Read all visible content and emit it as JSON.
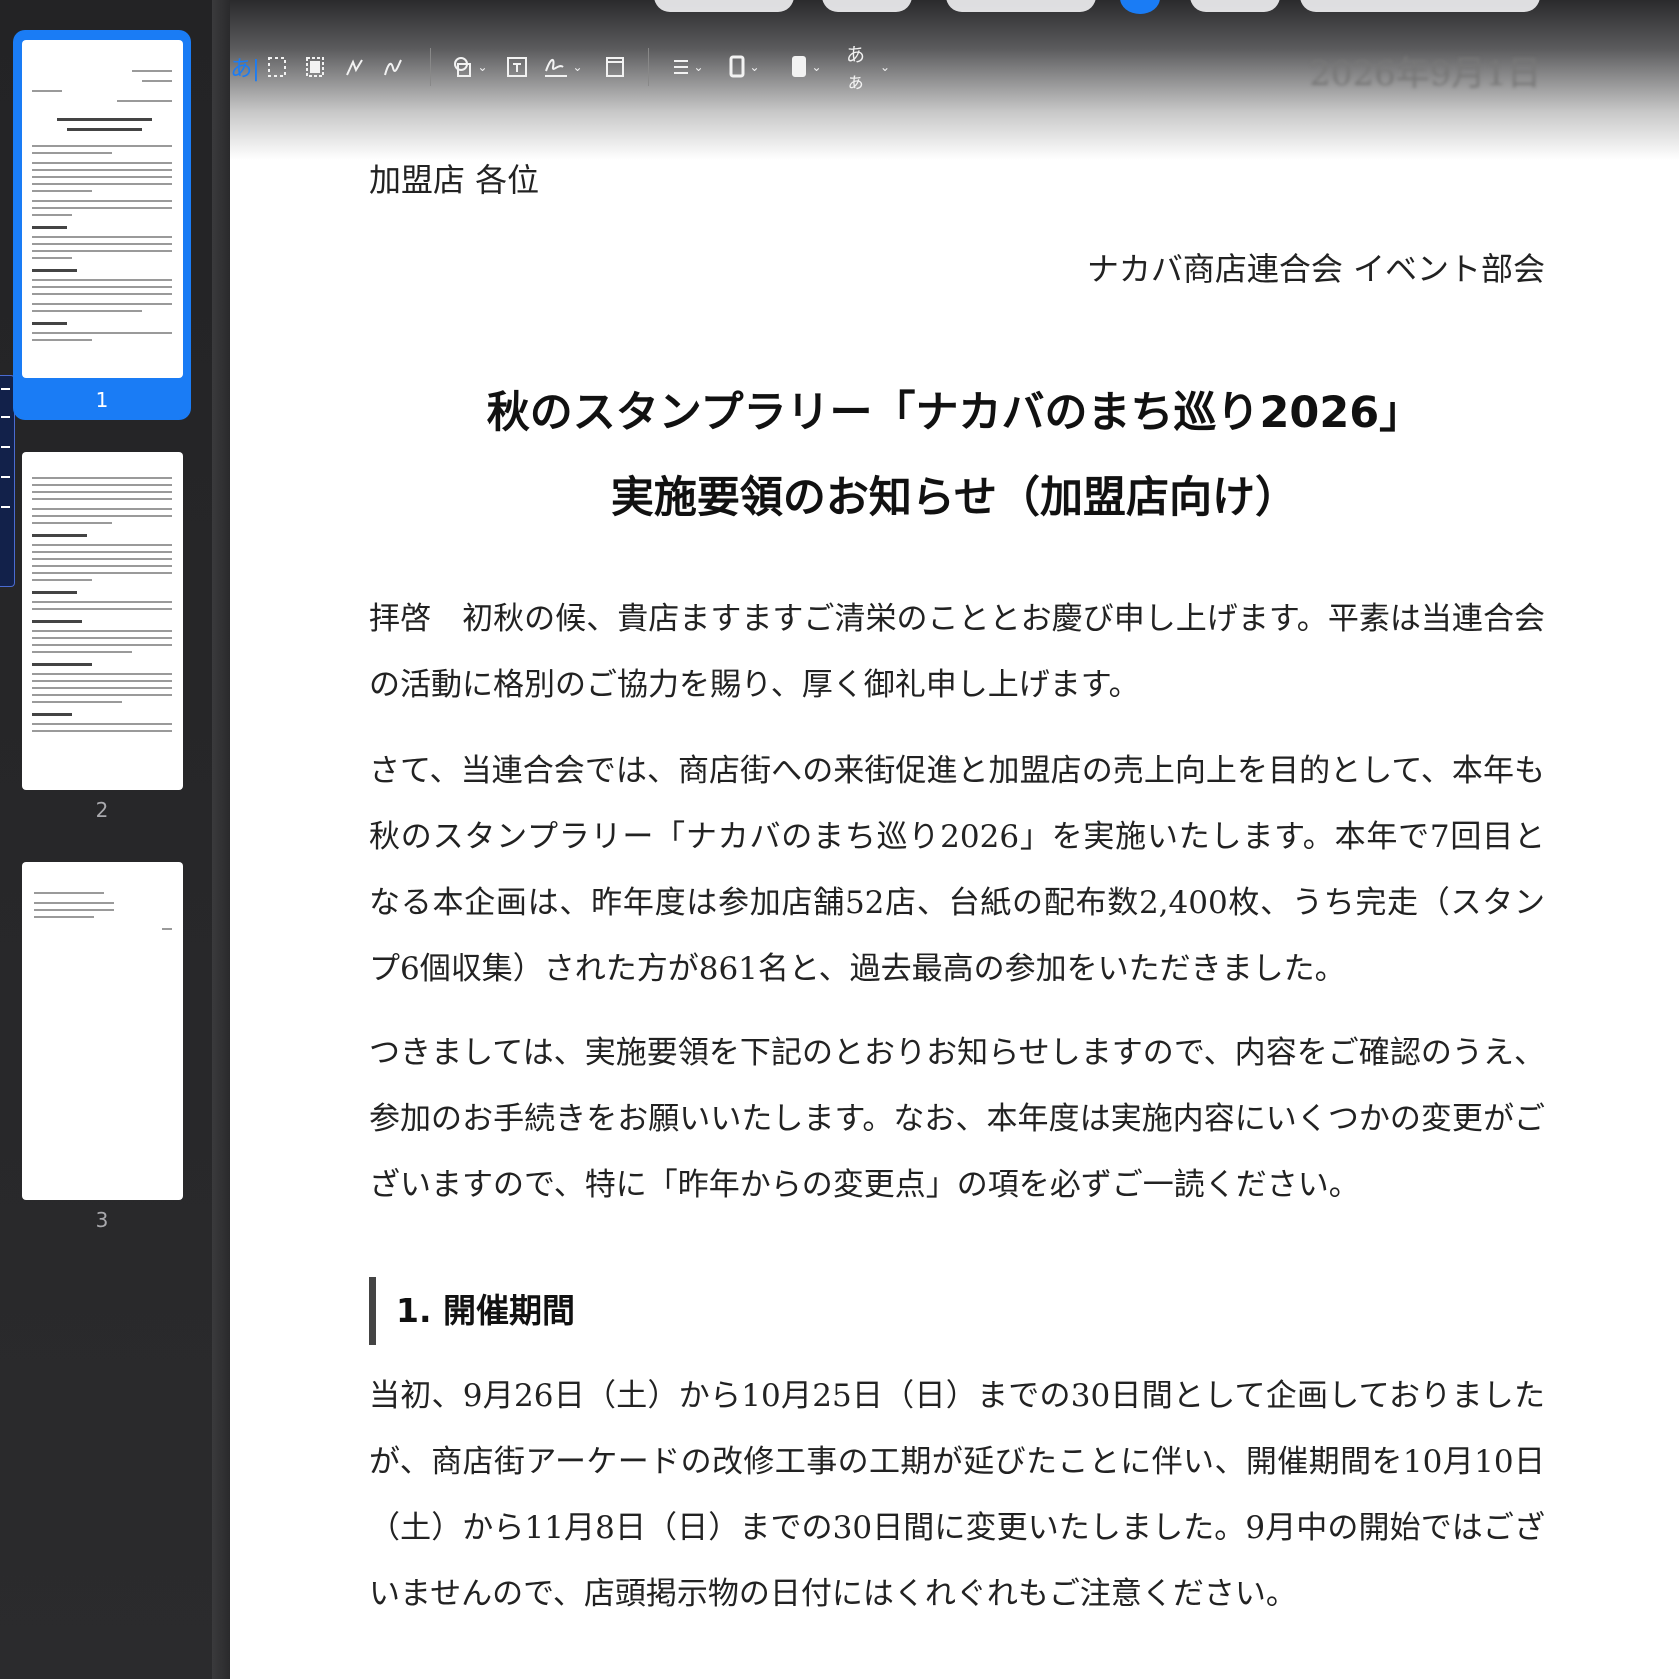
{
  "sidebar": {
    "pages": [
      {
        "number": "1",
        "selected": true
      },
      {
        "number": "2",
        "selected": false
      },
      {
        "number": "3",
        "selected": false
      }
    ]
  },
  "toolbar": {
    "tools": [
      "text-insert-icon",
      "rect-select-icon",
      "smart-select-icon",
      "sketch-icon",
      "draw-icon",
      "shapes-icon",
      "text-box-icon",
      "sign-icon",
      "note-icon",
      "align-icon",
      "border-color-icon",
      "fill-color-icon",
      "font-style-icon"
    ],
    "font_style_label": "あぁ",
    "accent_color": "#1a7cf5"
  },
  "document": {
    "date": "2026年9月1日",
    "recipient": "加盟店 各位",
    "sender": "ナカバ商店連合会 イベント部会",
    "title_line1": "秋のスタンプラリー「ナカバのまち巡り2026」",
    "title_line2": "実施要領のお知らせ（加盟店向け）",
    "paragraphs": [
      "拝啓　初秋の候、貴店ますますご清栄のこととお慶び申し上げます。平素は当連合会の活動に格別のご協力を賜り、厚く御礼申し上げます。",
      "さて、当連合会では、商店街への来街促進と加盟店の売上向上を目的として、本年も秋のスタンプラリー「ナカバのまち巡り2026」を実施いたします。本年で7回目となる本企画は、昨年度は参加店舗52店、台紙の配布数2,400枚、うち完走（スタンプ6個収集）された方が861名と、過去最高の参加をいただきました。",
      "つきましては、実施要領を下記のとおりお知らせしますので、内容をご確認のうえ、参加のお手続きをお願いいたします。なお、本年度は実施内容にいくつかの変更がございますので、特に「昨年からの変更点」の項を必ずご一読ください。"
    ],
    "section1_heading": "1. 開催期間",
    "section1_text": "当初、9月26日（土）から10月25日（日）までの30日間として企画しておりましたが、商店街アーケードの改修工事の工期が延びたことに伴い、開催期間を10月10日（土）から11月8日（日）までの30日間に変更いたしました。9月中の開始ではございませんので、店頭掲示物の日付にはくれぐれもご注意ください。"
  }
}
